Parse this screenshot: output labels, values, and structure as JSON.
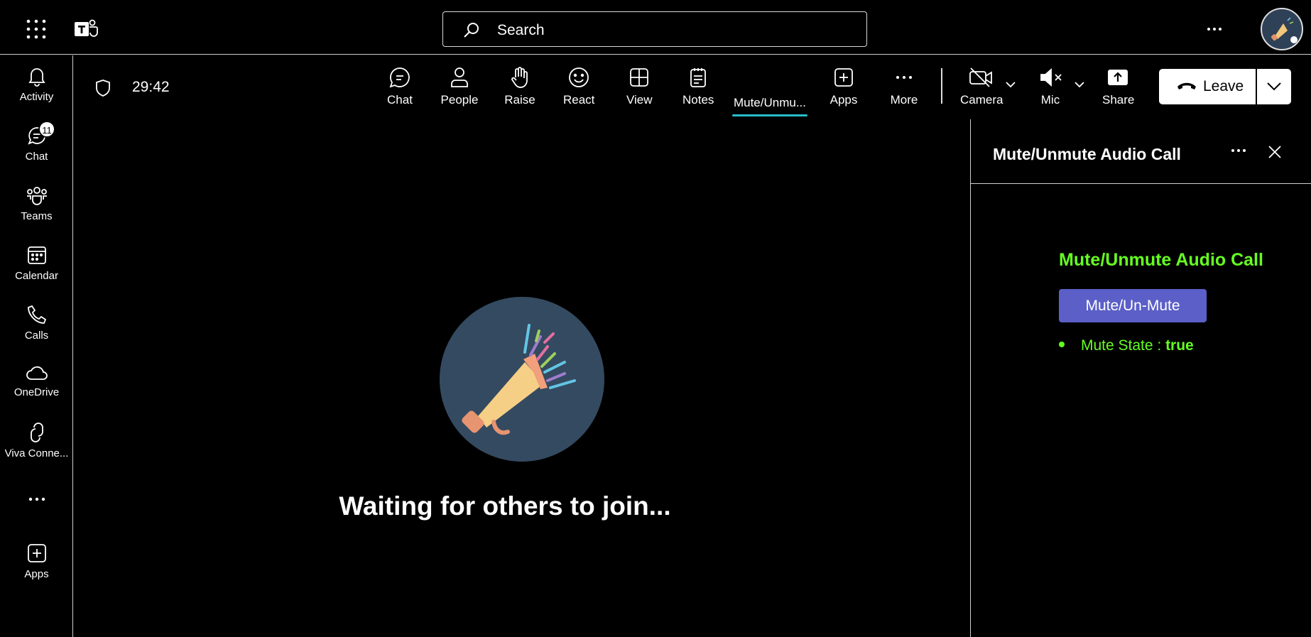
{
  "topbar": {
    "search_placeholder": "Search"
  },
  "rail": {
    "items": [
      {
        "label": "Activity",
        "icon": "bell-icon"
      },
      {
        "label": "Chat",
        "icon": "chat-icon",
        "badge": "11"
      },
      {
        "label": "Teams",
        "icon": "teams-icon"
      },
      {
        "label": "Calendar",
        "icon": "calendar-icon"
      },
      {
        "label": "Calls",
        "icon": "phone-icon"
      },
      {
        "label": "OneDrive",
        "icon": "cloud-icon"
      },
      {
        "label": "Viva Conne...",
        "icon": "viva-connections-icon"
      },
      {
        "label": "Apps",
        "icon": "add-apps-icon"
      }
    ]
  },
  "meeting": {
    "timer": "29:42",
    "controls": [
      {
        "label": "Chat",
        "icon": "chat-icon"
      },
      {
        "label": "People",
        "icon": "person-icon"
      },
      {
        "label": "Raise",
        "icon": "hand-icon"
      },
      {
        "label": "React",
        "icon": "smile-icon"
      },
      {
        "label": "View",
        "icon": "grid-icon"
      },
      {
        "label": "Notes",
        "icon": "notes-icon"
      },
      {
        "label": "Mute/Unmu...",
        "icon": "",
        "active": true
      },
      {
        "label": "Apps",
        "icon": "add-apps-icon"
      },
      {
        "label": "More",
        "icon": "ellipsis-icon"
      },
      {
        "label": "Camera",
        "icon": "camera-off-icon"
      },
      {
        "label": "Mic",
        "icon": "mic-muted-icon"
      },
      {
        "label": "Share",
        "icon": "share-icon"
      }
    ],
    "leave_label": "Leave",
    "waiting_text": "Waiting for others to join..."
  },
  "panel": {
    "title": "Mute/Unmute Audio Call",
    "app_heading": "Mute/Unmute Audio Call",
    "button_label": "Mute/Un-Mute",
    "state_label": "Mute State : ",
    "state_value": "true"
  },
  "colors": {
    "accent_green": "#66ff22",
    "button_purple": "#5b5fc7",
    "active_underline": "#29bcc8",
    "hero_bg": "#344a60"
  }
}
